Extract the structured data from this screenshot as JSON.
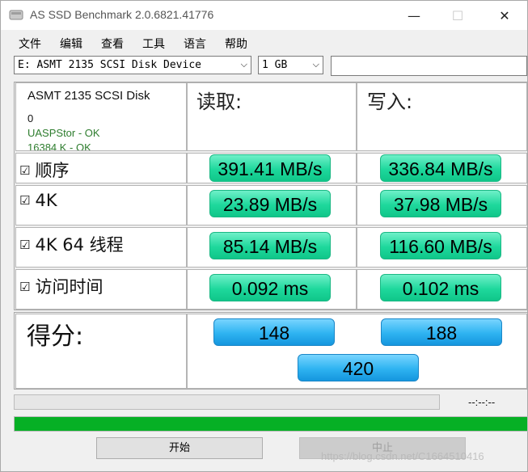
{
  "window": {
    "title": "AS SSD Benchmark 2.0.6821.41776",
    "controls": {
      "minimize": "—",
      "maximize": "☐",
      "close": "✕"
    }
  },
  "menu": [
    "文件",
    "编辑",
    "查看",
    "工具",
    "语言",
    "帮助"
  ],
  "drive_select": {
    "value": "E: ASMT 2135 SCSI Disk Device"
  },
  "size_select": {
    "value": "1 GB"
  },
  "search_input": {
    "value": ""
  },
  "device": {
    "name": "ASMT 2135 SCSI Disk",
    "line2": "0",
    "driver_status": "UASPStor - OK",
    "alignment_status": "16384 K - OK"
  },
  "columns": {
    "read": "读取:",
    "write": "写入:"
  },
  "rows": [
    {
      "label": "顺序",
      "checked": true,
      "read": "391.41 MB/s",
      "write": "336.84 MB/s"
    },
    {
      "label": "4K",
      "checked": true,
      "read": "23.89 MB/s",
      "write": "37.98 MB/s"
    },
    {
      "label": "4K 64 线程",
      "checked": true,
      "read": "85.14 MB/s",
      "write": "116.60 MB/s"
    },
    {
      "label": "访问时间",
      "checked": true,
      "read": "0.092 ms",
      "write": "0.102 ms"
    }
  ],
  "score": {
    "label": "得分:",
    "read": "148",
    "write": "188",
    "total": "420"
  },
  "progress": {
    "task_fraction": 0,
    "overall_fraction": 1,
    "time_text": "--:--:--"
  },
  "buttons": {
    "start": "开始",
    "stop": "中止"
  },
  "watermark": "https://blog.csdn.net/C1664510416",
  "colors": {
    "result_green": "#1ed89c",
    "score_blue": "#2eb3f1",
    "progress_green": "#06b025",
    "device_status_green": "#2e7d2e"
  },
  "icons": {
    "app": "disk-icon",
    "checkbox": "checkbox-checked-icon",
    "dropdown": "chevron-down-icon"
  }
}
